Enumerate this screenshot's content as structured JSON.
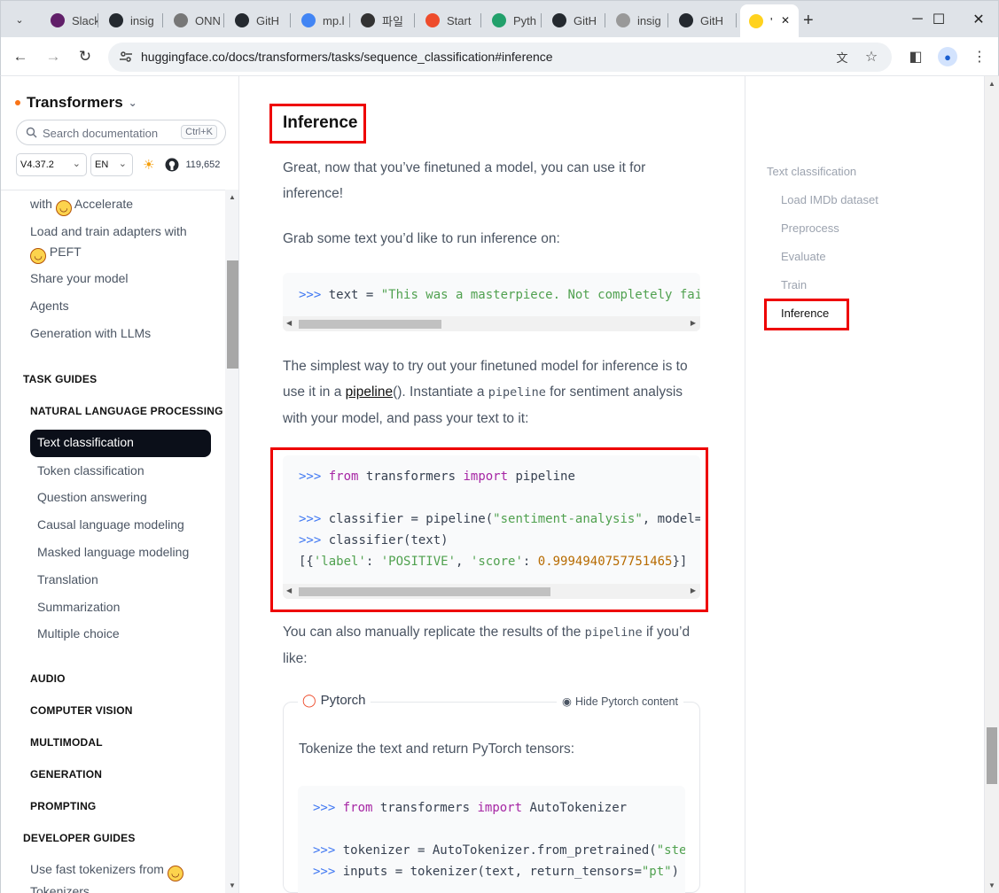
{
  "browser": {
    "tabs": [
      {
        "label": "Slack",
        "icon": "slack-icon",
        "color": "#611f69"
      },
      {
        "label": "insig",
        "icon": "github-icon",
        "color": "#24292f"
      },
      {
        "label": "ONN",
        "icon": "onnx-icon",
        "color": "#777777"
      },
      {
        "label": "GitH",
        "icon": "github-icon",
        "color": "#24292f"
      },
      {
        "label": "mp.l",
        "icon": "google-icon",
        "color": "#4285f4"
      },
      {
        "label": "파일",
        "icon": "file-icon",
        "color": "#333333"
      },
      {
        "label": "Start",
        "icon": "pytorch-icon",
        "color": "#ee4c2c"
      },
      {
        "label": "Pyth",
        "icon": "python-icon",
        "color": "#22a06b"
      },
      {
        "label": "GitH",
        "icon": "github-icon",
        "color": "#24292f"
      },
      {
        "label": "insig",
        "icon": "cube-icon",
        "color": "#999999"
      },
      {
        "label": "GitH",
        "icon": "github-icon",
        "color": "#24292f"
      },
      {
        "label": "'",
        "icon": "huggingface-icon",
        "color": "#ffd21e"
      }
    ],
    "url": "huggingface.co/docs/transformers/tasks/sequence_classification#inference"
  },
  "sidebar": {
    "title": "Transformers",
    "search_placeholder": "Search documentation",
    "search_shortcut": "Ctrl+K",
    "version": "V4.37.2",
    "language": "EN",
    "github_stars": "119,652",
    "items_top": [
      {
        "label": "with",
        "suffix": "Accelerate"
      },
      {
        "label": "Load and train adapters with",
        "suffix": "PEFT"
      },
      {
        "label": "Share your model"
      },
      {
        "label": "Agents"
      },
      {
        "label": "Generation with LLMs"
      }
    ],
    "section_task_guides": "TASK GUIDES",
    "subsection_nlp": "NATURAL LANGUAGE PROCESSING",
    "active_item": "Text classification",
    "nlp_items": [
      "Token classification",
      "Question answering",
      "Causal language modeling",
      "Masked language modeling",
      "Translation",
      "Summarization",
      "Multiple choice"
    ],
    "subsections": [
      "AUDIO",
      "COMPUTER VISION",
      "MULTIMODAL",
      "GENERATION",
      "PROMPTING"
    ],
    "section_developer_guides": "DEVELOPER GUIDES",
    "dev_item": "Use fast tokenizers from",
    "dev_item_suffix": "Tokenizers"
  },
  "main": {
    "heading": "Inference",
    "para1": "Great, now that you’ve finetuned a model, you can use it for inference!",
    "para2": "Grab some text you’d like to run inference on:",
    "code1": {
      "prompt": ">>>",
      "text": " text = ",
      "string": "\"This was a masterpiece. Not completely fai"
    },
    "para3_a": "The simplest way to try out your finetuned model for inference is to use it in a ",
    "para3_link": "pipeline",
    "para3_b": "(). Instantiate a ",
    "para3_code": "pipeline",
    "para3_c": " for sentiment analysis with your model, and pass your text to it:",
    "code2": {
      "l1_prompt": ">>>",
      "l1_from": "from",
      "l1_mod": " transformers ",
      "l1_import": "import",
      "l1_name": " pipeline",
      "l2_prompt": ">>>",
      "l2_a": " classifier = pipeline(",
      "l2_str": "\"sentiment-analysis\"",
      "l2_b": ", model=",
      "l3_prompt": ">>>",
      "l3_a": " classifier(text)",
      "l4_a": "[{",
      "l4_k1": "'label'",
      "l4_b": ": ",
      "l4_v1": "'POSITIVE'",
      "l4_c": ", ",
      "l4_k2": "'score'",
      "l4_d": ": ",
      "l4_v2": "0.9994940757751465",
      "l4_e": "}]"
    },
    "para4_a": "You can also manually replicate the results of the ",
    "para4_code": "pipeline",
    "para4_b": " if you’d like:",
    "framework": {
      "name": "Pytorch",
      "hide_label": "Hide Pytorch content",
      "text": "Tokenize the text and return PyTorch tensors:",
      "l1_prompt": ">>>",
      "l1_from": "from",
      "l1_mod": " transformers ",
      "l1_import": "import",
      "l1_name": " AutoTokenizer",
      "l2_prompt": ">>>",
      "l2_a": " tokenizer = AutoTokenizer.from_pretrained(",
      "l2_str": "\"ste",
      "l3_prompt": ">>>",
      "l3_a": " inputs = tokenizer(text, return_tensors=",
      "l3_str": "\"pt\"",
      "l3_b": ")"
    }
  },
  "toc": {
    "items": [
      {
        "label": "Text classification",
        "indent": false
      },
      {
        "label": "Load IMDb dataset",
        "indent": true
      },
      {
        "label": "Preprocess",
        "indent": true
      },
      {
        "label": "Evaluate",
        "indent": true
      },
      {
        "label": "Train",
        "indent": true
      },
      {
        "label": "Inference",
        "indent": true,
        "active": true
      }
    ]
  },
  "colors": {
    "highlight": "#e00000",
    "active_nav": "#0b0f19",
    "brand_dot": "#f97316"
  }
}
